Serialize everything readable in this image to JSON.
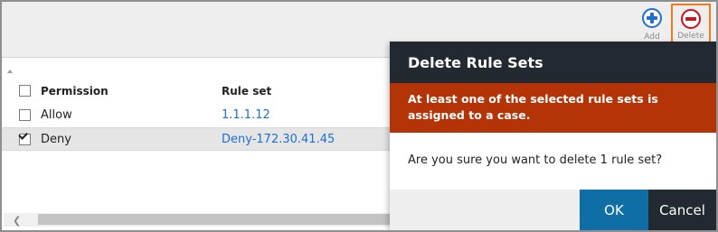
{
  "toolbar": {
    "add_label": "Add",
    "add_icon": "plus-circle-icon",
    "delete_label": "Delete",
    "delete_icon": "minus-circle-icon"
  },
  "grid": {
    "columns": [
      "Permission",
      "Rule set"
    ],
    "rows": [
      {
        "permission": "Allow",
        "rule_set": "1.1.1.12",
        "checked": false
      },
      {
        "permission": "Deny",
        "rule_set": "Deny-172.30.41.45",
        "checked": true
      }
    ]
  },
  "dialog": {
    "title": "Delete Rule Sets",
    "error": "At least one of the selected rule sets is assigned to a case.",
    "message": "Are you sure you want to delete 1 rule set?",
    "ok_label": "OK",
    "cancel_label": "Cancel"
  },
  "colors": {
    "dialog_header": "#222931",
    "error_banner": "#b53407",
    "ok_button": "#0f6ea6",
    "link": "#1f6fd0",
    "highlight_border": "#f07b1e"
  }
}
